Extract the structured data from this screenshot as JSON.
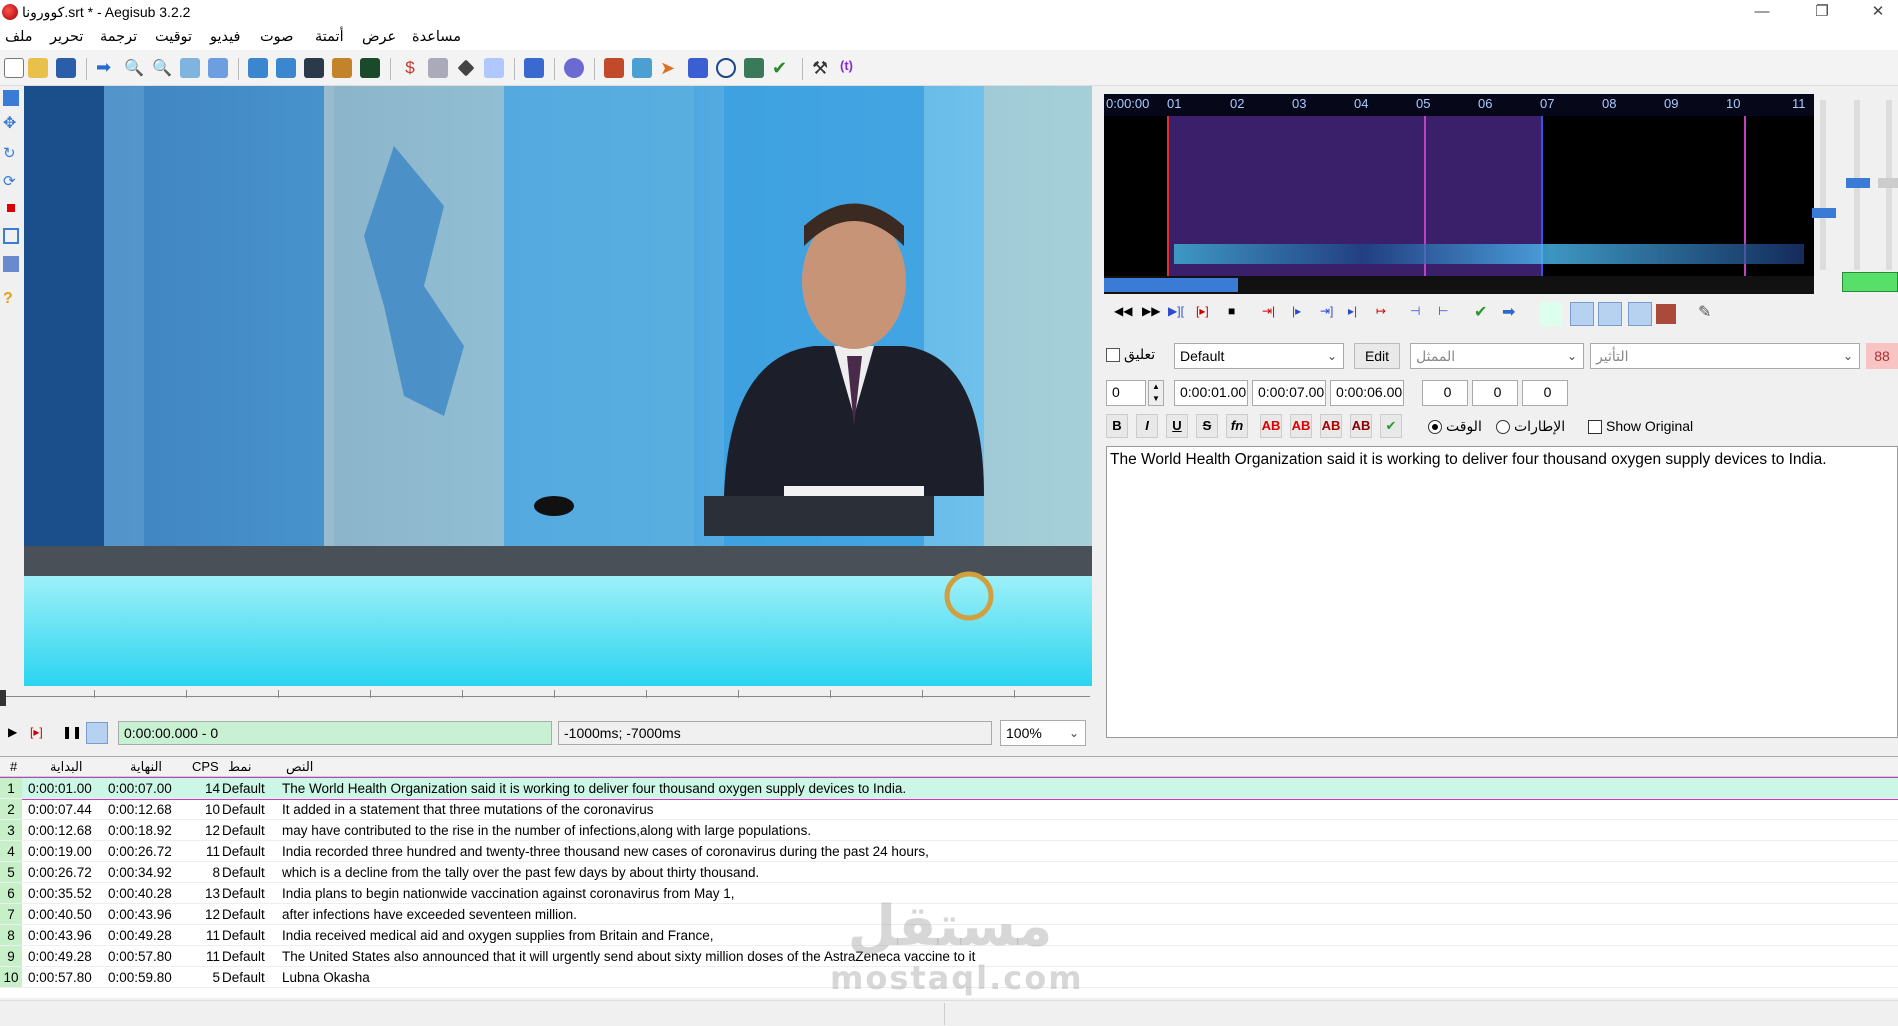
{
  "window": {
    "title": "كوورونا.srt * - Aegisub 3.2.2",
    "minimize": "—",
    "maximize": "❐",
    "close": "✕"
  },
  "menu": [
    "ملف",
    "تحرير",
    "ترجمة",
    "توقيت",
    "فيديو",
    "صوت",
    "أتمتة",
    "عرض",
    "مساعدة"
  ],
  "video": {
    "time_display": "0:00:00.000 - 0",
    "offset_display": "-1000ms; -7000ms",
    "zoom": "100%"
  },
  "audio": {
    "ruler_labels": [
      "0:00:00",
      "01",
      "02",
      "03",
      "04",
      "05",
      "06",
      "07",
      "08",
      "09",
      "10",
      "11"
    ]
  },
  "editor": {
    "comment_label": "تعليق",
    "style": "Default",
    "edit_button": "Edit",
    "actor_placeholder": "الممثل",
    "effect_placeholder": "التأثير",
    "char_count": "88",
    "layer": "0",
    "start_time": "0:00:01.00",
    "end_time": "0:00:07.00",
    "duration": "0:00:06.00",
    "margin_l": "0",
    "margin_r": "0",
    "margin_v": "0",
    "fmt_bold": "B",
    "fmt_italic": "I",
    "fmt_underline": "U",
    "fmt_strike": "S",
    "fmt_font": "fn",
    "fmt_color": "AB",
    "radio_time": "الوقت",
    "radio_frames": "الإطارات",
    "show_original": "Show Original",
    "text": "The World Health Organization said it is working to deliver four thousand oxygen supply devices to India."
  },
  "grid": {
    "headers": {
      "num": "#",
      "start": "البداية",
      "end": "النهاية",
      "cps": "CPS",
      "style": "نمط",
      "text": "النص"
    },
    "rows": [
      {
        "num": "1",
        "start": "0:00:01.00",
        "end": "0:00:07.00",
        "cps": "14",
        "style": "Default",
        "text": "The World Health Organization said it is working to deliver four thousand oxygen supply devices to India."
      },
      {
        "num": "2",
        "start": "0:00:07.44",
        "end": "0:00:12.68",
        "cps": "10",
        "style": "Default",
        "text": "It added in a statement that three mutations of the coronavirus"
      },
      {
        "num": "3",
        "start": "0:00:12.68",
        "end": "0:00:18.92",
        "cps": "12",
        "style": "Default",
        "text": "may have contributed to the rise in the number of infections,along with large populations."
      },
      {
        "num": "4",
        "start": "0:00:19.00",
        "end": "0:00:26.72",
        "cps": "11",
        "style": "Default",
        "text": "India recorded three hundred and twenty-three thousand new cases of coronavirus during the past 24 hours,"
      },
      {
        "num": "5",
        "start": "0:00:26.72",
        "end": "0:00:34.92",
        "cps": "8",
        "style": "Default",
        "text": "which is a decline from the tally over the past few days by about thirty thousand."
      },
      {
        "num": "6",
        "start": "0:00:35.52",
        "end": "0:00:40.28",
        "cps": "13",
        "style": "Default",
        "text": "India plans to begin nationwide vaccination against coronavirus from May 1,"
      },
      {
        "num": "7",
        "start": "0:00:40.50",
        "end": "0:00:43.96",
        "cps": "12",
        "style": "Default",
        "text": "after infections have exceeded seventeen million."
      },
      {
        "num": "8",
        "start": "0:00:43.96",
        "end": "0:00:49.28",
        "cps": "11",
        "style": "Default",
        "text": "India received medical aid and oxygen supplies from Britain and France,"
      },
      {
        "num": "9",
        "start": "0:00:49.28",
        "end": "0:00:57.80",
        "cps": "11",
        "style": "Default",
        "text": "The United States also announced that it will urgently send about sixty million doses of the AstraZeneca vaccine to it"
      },
      {
        "num": "10",
        "start": "0:00:57.80",
        "end": "0:00:59.80",
        "cps": "5",
        "style": "Default",
        "text": "Lubna Okasha"
      }
    ]
  },
  "watermark": {
    "arabic": "مستقل",
    "latin": "mostaql.com"
  },
  "colors": {
    "accent": "#3a7bd5",
    "selected_row": "#ccf7e6",
    "time_field": "#c8f0d2",
    "char_count_bg": "#f7c3c3"
  }
}
